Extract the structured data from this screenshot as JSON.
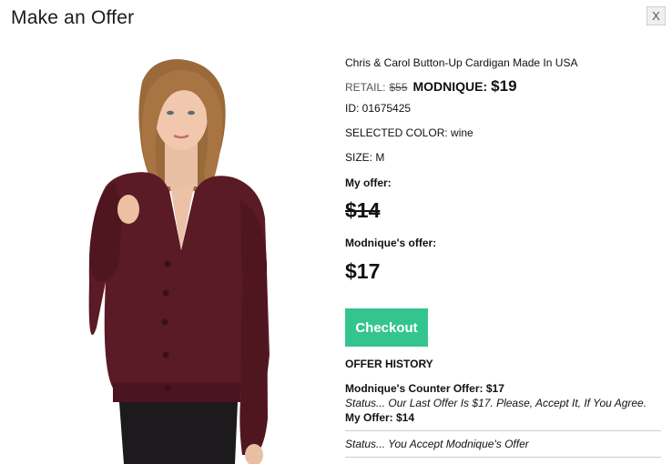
{
  "modal": {
    "title": "Make an Offer",
    "close_label": "X"
  },
  "product": {
    "name": "Chris & Carol Button-Up Cardigan Made In USA",
    "retail_label": "RETAIL:",
    "retail_price": "$55",
    "brand_label": "MODNIQUE:",
    "brand_price": "$19",
    "id_line": "ID: 01675425",
    "color_line": "SELECTED COLOR: wine",
    "size_line": "SIZE: M",
    "image_alt": "Model wearing wine button-up cardigan"
  },
  "offers": {
    "my_label": "My offer:",
    "my_value": "$14",
    "their_label": "Modnique's offer:",
    "their_value": "$17"
  },
  "checkout_label": "Checkout",
  "history": {
    "title": "OFFER HISTORY",
    "counter_offer": "Modnique's Counter Offer: $17",
    "counter_status": "Status... Our Last Offer Is $17. Please, Accept It, If You Agree.",
    "my_offer": "My Offer: $14",
    "accept_status": "Status... You Accept Modnique's Offer"
  },
  "colors": {
    "accent": "#34c58f",
    "cardigan": "#5a1a26"
  }
}
